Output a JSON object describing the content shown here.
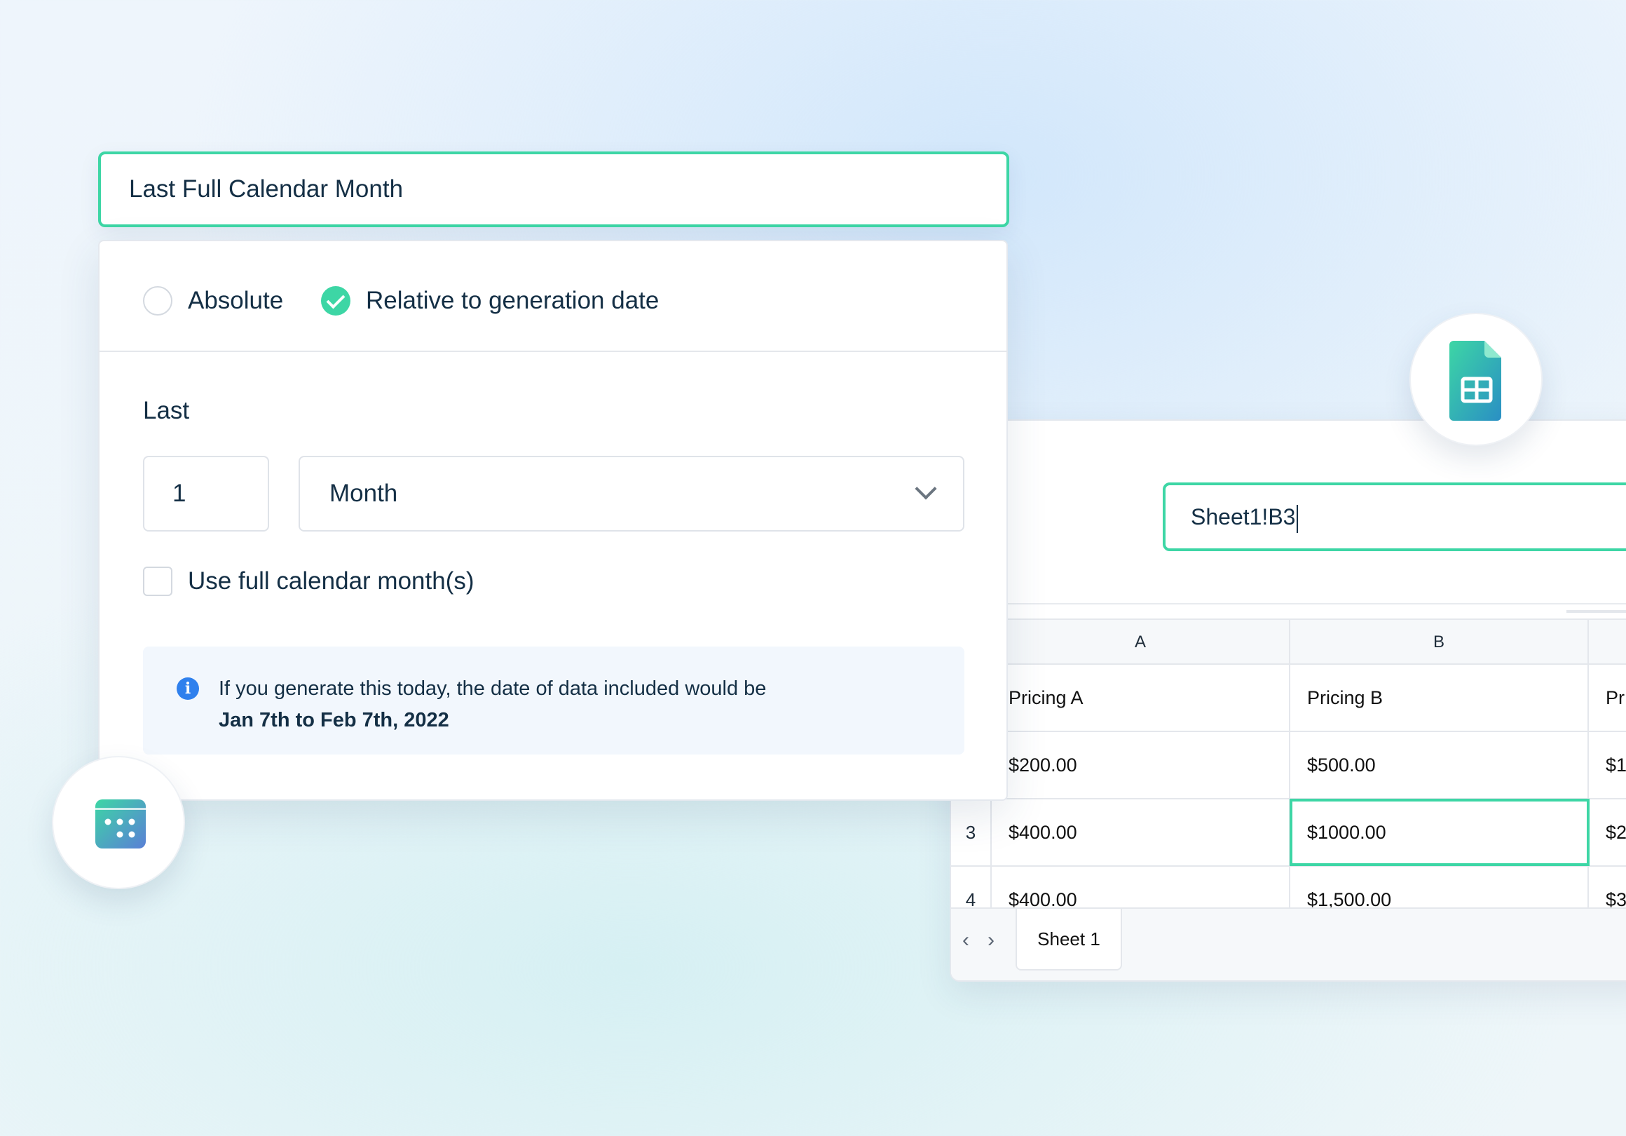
{
  "date_range": {
    "title": "Last Full Calendar Month",
    "modes": [
      {
        "label": "Absolute",
        "checked": false
      },
      {
        "label": "Relative to generation date",
        "checked": true
      }
    ],
    "last_label": "Last",
    "amount": "1",
    "unit": "Month",
    "full_calendar_checkbox": {
      "label": "Use full calendar month(s)",
      "checked": false
    },
    "info": {
      "text": "If you generate this today, the date of data included would be",
      "range": "Jan 7th to Feb 7th, 2022"
    }
  },
  "spreadsheet": {
    "cell_reference": "Sheet1!B3",
    "columns": [
      "A",
      "B"
    ],
    "rows": [
      {
        "num": "",
        "cells": [
          "Pricing A",
          "Pricing B",
          "Pr"
        ]
      },
      {
        "num": "",
        "cells": [
          "$200.00",
          "$500.00",
          "$1"
        ]
      },
      {
        "num": "3",
        "cells": [
          "$400.00",
          "$1000.00",
          "$2"
        ]
      },
      {
        "num": "4",
        "cells": [
          "$400.00",
          "$1,500.00",
          "$3"
        ]
      }
    ],
    "selected_cell": "B3",
    "sheet_tab": "Sheet 1"
  },
  "icons": {
    "calendar": "calendar-icon",
    "sheets": "google-sheets-icon",
    "info": "info-icon",
    "prev": "chevron-left-icon",
    "next": "chevron-right-icon",
    "dropdown": "chevron-down-icon"
  },
  "colors": {
    "accent": "#3dd6a5",
    "info_blue": "#2f80ed",
    "text": "#142f45"
  }
}
